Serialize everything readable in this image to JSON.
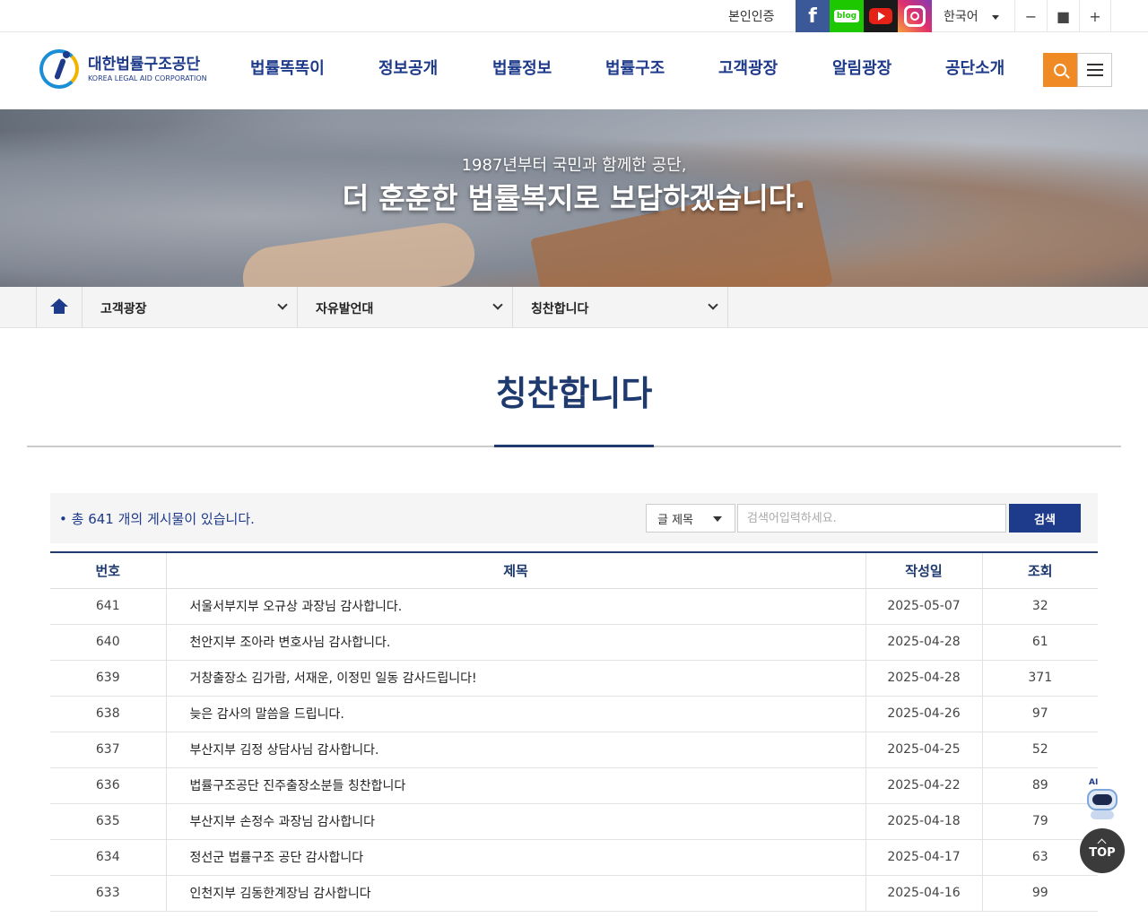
{
  "topbar": {
    "verify": "본인인증",
    "social": {
      "facebook": "f",
      "blog": "blog"
    },
    "language": "한국어",
    "zoom": {
      "out": "−",
      "reset": "■",
      "in": "+"
    }
  },
  "header": {
    "logo_ko": "대한법률구조공단",
    "logo_en": "KOREA LEGAL AID CORPORATION",
    "nav": [
      "법률똑똑이",
      "정보공개",
      "법률정보",
      "법률구조",
      "고객광장",
      "알림광장",
      "공단소개"
    ]
  },
  "banner": {
    "sub": "1987년부터 국민과 함께한 공단,",
    "main": "더 훈훈한 법률복지로 보답하겠습니다."
  },
  "location": {
    "items": [
      "고객광장",
      "자유발언대",
      "칭찬합니다"
    ]
  },
  "page": {
    "title": "칭찬합니다"
  },
  "board": {
    "total_text": "총 641 개의 게시물이 있습니다.",
    "search_field": "글 제목",
    "search_placeholder": "검색어입력하세요.",
    "search_button": "검색",
    "columns": [
      "번호",
      "제목",
      "작성일",
      "조회"
    ],
    "rows": [
      {
        "no": "641",
        "title": "서울서부지부 오규상 과장님 감사합니다.",
        "date": "2025-05-07",
        "views": "32"
      },
      {
        "no": "640",
        "title": "천안지부 조아라 변호사님 감사합니다.",
        "date": "2025-04-28",
        "views": "61"
      },
      {
        "no": "639",
        "title": "거창출장소 김가람, 서재운, 이정민 일동 감사드립니다!",
        "date": "2025-04-28",
        "views": "371"
      },
      {
        "no": "638",
        "title": "늦은 감사의 말씀을 드립니다.",
        "date": "2025-04-26",
        "views": "97"
      },
      {
        "no": "637",
        "title": "부산지부 김정 상담사님 감사합니다.",
        "date": "2025-04-25",
        "views": "52"
      },
      {
        "no": "636",
        "title": "법률구조공단 진주출장소분들 칭찬합니다",
        "date": "2025-04-22",
        "views": "89"
      },
      {
        "no": "635",
        "title": "부산지부 손정수 과장님 감사합니다",
        "date": "2025-04-18",
        "views": "79"
      },
      {
        "no": "634",
        "title": "정선군 법률구조 공단 감사합니다",
        "date": "2025-04-17",
        "views": "63"
      },
      {
        "no": "633",
        "title": "인천지부 김동한계장님 감사합니다",
        "date": "2025-04-16",
        "views": "99"
      }
    ]
  },
  "floating": {
    "ai_label": "AI",
    "top_label": "TOP"
  }
}
